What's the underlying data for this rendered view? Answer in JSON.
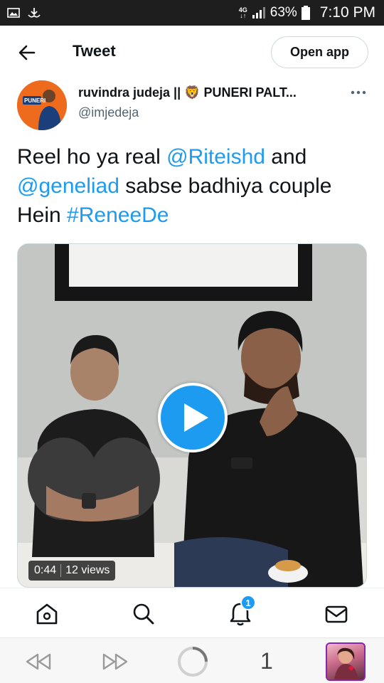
{
  "status_bar": {
    "network": "4G",
    "battery": "63%",
    "time": "7:10 PM"
  },
  "header": {
    "title": "Tweet",
    "open_app_label": "Open app"
  },
  "author": {
    "name": "ruvindra judeja || 🦁 PUNERI PALT...",
    "handle": "@imjedeja"
  },
  "tweet": {
    "text_1": "Reel ho ya real ",
    "mention_1": "@Riteishd",
    "text_2": " and ",
    "mention_2": "@geneliad",
    "text_3": " sabse badhiya couple Hein  ",
    "hashtag": "#ReneeDe"
  },
  "media": {
    "duration": "0:44",
    "views": "12 views"
  },
  "bottom_nav": {
    "notification_count": "1"
  },
  "browser": {
    "tab_count": "1"
  },
  "colors": {
    "accent": "#1d9bf0",
    "text": "#0f1419",
    "secondary": "#536471"
  }
}
